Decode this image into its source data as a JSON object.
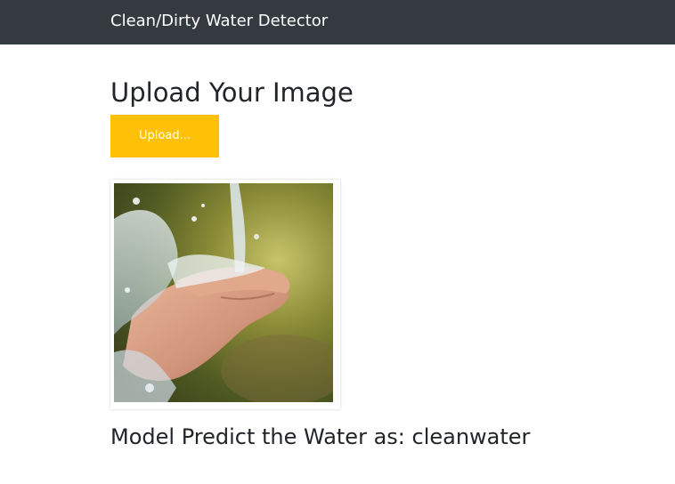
{
  "navbar": {
    "brand": "Clean/Dirty Water Detector",
    "background": "#343a40"
  },
  "main": {
    "heading": "Upload Your Image",
    "upload_button_label": "Upload...",
    "upload_button_color": "#ffc107",
    "prediction_text": "Model Predict the Water as: cleanwater"
  }
}
